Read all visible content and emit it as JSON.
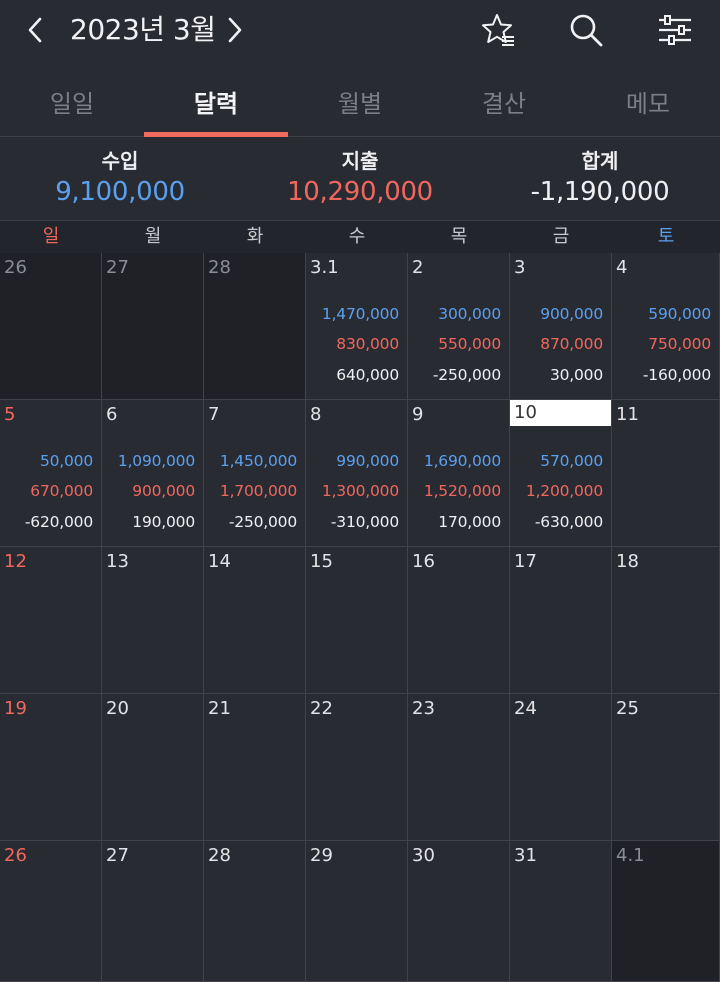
{
  "header": {
    "title": "2023년 3월"
  },
  "tabs": [
    {
      "label": "일일",
      "active": false
    },
    {
      "label": "달력",
      "active": true
    },
    {
      "label": "월별",
      "active": false
    },
    {
      "label": "결산",
      "active": false
    },
    {
      "label": "메모",
      "active": false
    }
  ],
  "summary": {
    "income_label": "수입",
    "income_value": "9,100,000",
    "expense_label": "지출",
    "expense_value": "10,290,000",
    "total_label": "합계",
    "total_value": "-1,190,000"
  },
  "weekdays": [
    "일",
    "월",
    "화",
    "수",
    "목",
    "금",
    "토"
  ],
  "colors": {
    "background": "#292b33",
    "income": "#5ba0ee",
    "expense": "#f0675d",
    "accent": "#f06a5e"
  },
  "icons": {
    "prev": "chevron-left-icon",
    "next": "chevron-right-icon",
    "favorite": "star-list-icon",
    "search": "search-icon",
    "filter": "sliders-icon"
  },
  "weeks": [
    [
      {
        "day": "26",
        "other": true
      },
      {
        "day": "27",
        "other": true
      },
      {
        "day": "28",
        "other": true
      },
      {
        "day": "3.1",
        "income": "1,470,000",
        "expense": "830,000",
        "total": "640,000"
      },
      {
        "day": "2",
        "income": "300,000",
        "expense": "550,000",
        "total": "-250,000"
      },
      {
        "day": "3",
        "income": "900,000",
        "expense": "870,000",
        "total": "30,000"
      },
      {
        "day": "4",
        "income": "590,000",
        "expense": "750,000",
        "total": "-160,000"
      }
    ],
    [
      {
        "day": "5",
        "income": "50,000",
        "expense": "670,000",
        "total": "-620,000"
      },
      {
        "day": "6",
        "income": "1,090,000",
        "expense": "900,000",
        "total": "190,000"
      },
      {
        "day": "7",
        "income": "1,450,000",
        "expense": "1,700,000",
        "total": "-250,000"
      },
      {
        "day": "8",
        "income": "990,000",
        "expense": "1,300,000",
        "total": "-310,000"
      },
      {
        "day": "9",
        "income": "1,690,000",
        "expense": "1,520,000",
        "total": "170,000"
      },
      {
        "day": "10",
        "today": true,
        "income": "570,000",
        "expense": "1,200,000",
        "total": "-630,000"
      },
      {
        "day": "11"
      }
    ],
    [
      {
        "day": "12"
      },
      {
        "day": "13"
      },
      {
        "day": "14"
      },
      {
        "day": "15"
      },
      {
        "day": "16"
      },
      {
        "day": "17"
      },
      {
        "day": "18"
      }
    ],
    [
      {
        "day": "19"
      },
      {
        "day": "20"
      },
      {
        "day": "21"
      },
      {
        "day": "22"
      },
      {
        "day": "23"
      },
      {
        "day": "24"
      },
      {
        "day": "25"
      }
    ],
    [
      {
        "day": "26"
      },
      {
        "day": "27"
      },
      {
        "day": "28"
      },
      {
        "day": "29"
      },
      {
        "day": "30"
      },
      {
        "day": "31"
      },
      {
        "day": "4.1",
        "other": true
      }
    ]
  ]
}
